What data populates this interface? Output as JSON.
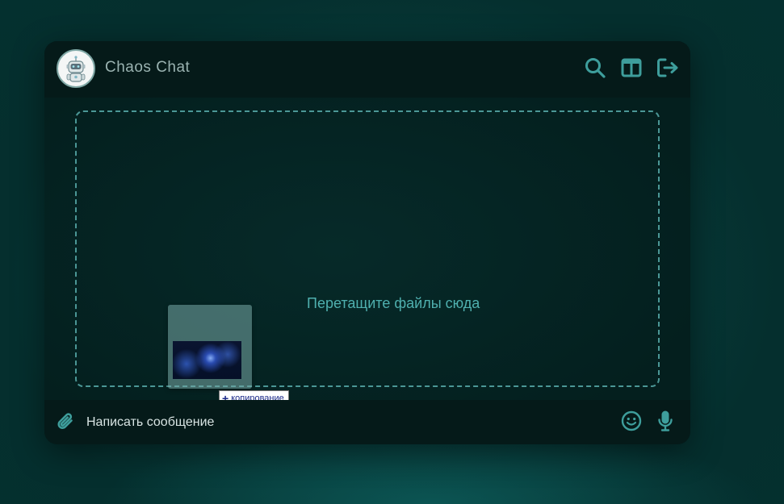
{
  "header": {
    "title": "Chaos Chat",
    "avatar_icon": "robot-avatar-icon",
    "actions": [
      {
        "name": "search",
        "icon": "search-icon"
      },
      {
        "name": "layout",
        "icon": "layout-panel-icon"
      },
      {
        "name": "logout",
        "icon": "logout-icon"
      }
    ]
  },
  "dropzone": {
    "text": "Перетащите файлы сюда"
  },
  "drag": {
    "tooltip": "копирование",
    "tooltip_icon": "plus-icon"
  },
  "composer": {
    "placeholder": "Написать сообщение",
    "value": "",
    "attach_icon": "paperclip-icon",
    "emoji_icon": "smiley-icon",
    "mic_icon": "microphone-icon"
  },
  "colors": {
    "accent": "#3e9e9c",
    "background": "#052f2e",
    "panel": "#051a19",
    "dropzone_border": "#4b9796",
    "dropzone_text": "#4fb0af"
  }
}
